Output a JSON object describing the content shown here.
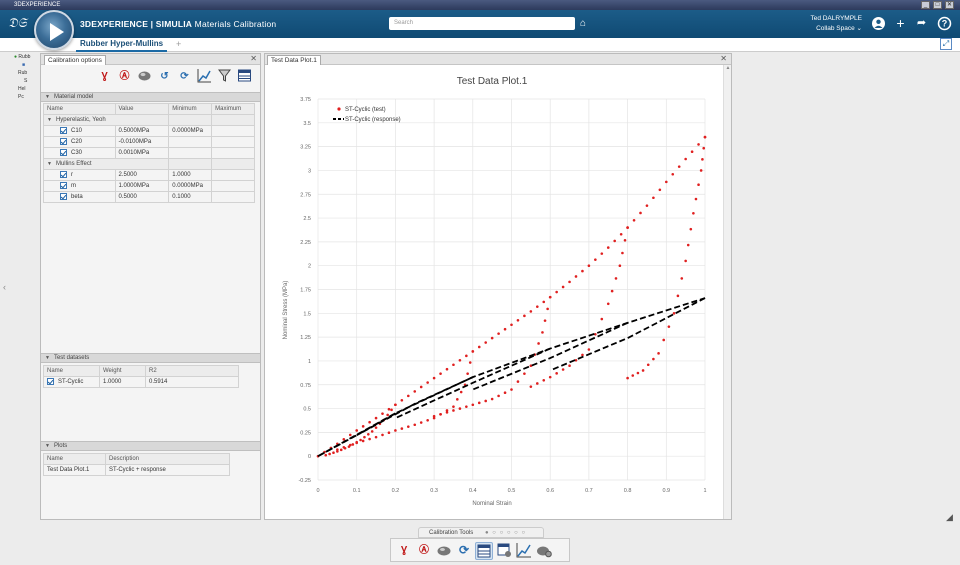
{
  "window": {
    "title": "3DEXPERIENCE",
    "controls": [
      "_",
      "□",
      "✕"
    ]
  },
  "appbar": {
    "brand_prefix": "3D",
    "brand_main": "EXPERIENCE | SIMULIA",
    "brand_app": " Materials Calibration",
    "search_placeholder": "Search",
    "user_name": "Ted DALRYMPLE",
    "collab_space": "Collab Space ⌄"
  },
  "tabs": {
    "active": "Rubber Hyper-Mullins",
    "add": "+"
  },
  "tree": {
    "items": [
      "Rubb",
      "Rub",
      "S",
      "Hel",
      "Pc"
    ]
  },
  "calibration_panel": {
    "title": "Calibration options",
    "close": "✕",
    "material_model": {
      "header": "Material model",
      "columns": [
        "Name",
        "Value",
        "Minimum",
        "Maximum"
      ],
      "groups": [
        {
          "name": "Hyperelastic, Yeoh",
          "rows": [
            {
              "name": "C10",
              "value": "0.5000MPa",
              "min": "0.0000MPa",
              "max": ""
            },
            {
              "name": "C20",
              "value": "-0.0100MPa",
              "min": "",
              "max": ""
            },
            {
              "name": "C30",
              "value": "0.0010MPa",
              "min": "",
              "max": ""
            }
          ]
        },
        {
          "name": "Mullins Effect",
          "rows": [
            {
              "name": "r",
              "value": "2.5000",
              "min": "1.0000",
              "max": ""
            },
            {
              "name": "m",
              "value": "1.0000MPa",
              "min": "0.0000MPa",
              "max": ""
            },
            {
              "name": "beta",
              "value": "0.5000",
              "min": "0.1000",
              "max": ""
            }
          ]
        }
      ]
    },
    "test_datasets": {
      "header": "Test datasets",
      "columns": [
        "Name",
        "Weight",
        "R2"
      ],
      "rows": [
        {
          "name": "ST-Cyclic",
          "weight": "1.0000",
          "r2": "0.5914"
        }
      ]
    },
    "plots": {
      "header": "Plots",
      "columns": [
        "Name",
        "Description"
      ],
      "rows": [
        {
          "name": "Test Data Plot.1",
          "description": "ST-Cyclic + response"
        }
      ]
    }
  },
  "plot_pane": {
    "tab": "Test Data Plot.1",
    "close": "✕"
  },
  "bottom": {
    "tools_label": "Calibration Tools",
    "dots": "● ○ ○ ○ ○ ○"
  },
  "colors": {
    "appbar": "#1c5c88",
    "test_points": "#e02020",
    "response_line": "#000000"
  },
  "chart_data": {
    "type": "scatter",
    "title": "Test Data Plot.1",
    "xlabel": "Nominal Strain",
    "ylabel": "Nominal Stress (MPa)",
    "xlim": [
      0,
      1
    ],
    "ylim": [
      -0.25,
      3.75
    ],
    "x_ticks": [
      "0",
      "0.1",
      "0.2",
      "0.3",
      "0.4",
      "0.5",
      "0.6",
      "0.7",
      "0.8",
      "0.9",
      "1"
    ],
    "y_ticks": [
      "-0.25",
      "0",
      "0.25",
      "0.5",
      "0.75",
      "1",
      "1.25",
      "1.5",
      "1.75",
      "2",
      "2.25",
      "2.5",
      "2.75",
      "3",
      "3.25",
      "3.5",
      "3.75"
    ],
    "grid": true,
    "legend_position": "top-left",
    "series": [
      {
        "name": "ST-Cyclic (test)",
        "style": "dots",
        "color": "#e02020",
        "loops": [
          {
            "x": [
              0,
              0.05,
              0.1,
              0.15,
              0.2,
              0.25,
              0.3,
              0.35,
              0.4,
              0.45,
              0.5,
              0.55,
              0.6,
              0.65,
              0.7,
              0.75,
              0.8,
              0.85,
              0.9,
              0.95,
              1.0
            ],
            "y": [
              0,
              0.13,
              0.27,
              0.4,
              0.54,
              0.68,
              0.82,
              0.96,
              1.1,
              1.24,
              1.38,
              1.52,
              1.67,
              1.83,
              2.0,
              2.19,
              2.4,
              2.63,
              2.88,
              3.12,
              3.35
            ]
          },
          {
            "x": [
              0.2,
              0.17,
              0.14,
              0.11,
              0.08,
              0.05,
              0.02
            ],
            "y": [
              0.54,
              0.38,
              0.26,
              0.17,
              0.1,
              0.05,
              0.01
            ]
          },
          {
            "x": [
              0.4,
              0.38,
              0.35,
              0.3,
              0.25,
              0.2,
              0.15,
              0.1,
              0.05
            ],
            "y": [
              1.1,
              0.75,
              0.52,
              0.4,
              0.33,
              0.27,
              0.2,
              0.14,
              0.07
            ]
          },
          {
            "x": [
              0.6,
              0.58,
              0.55,
              0.5,
              0.45,
              0.4,
              0.35,
              0.3
            ],
            "y": [
              1.67,
              1.3,
              0.95,
              0.7,
              0.6,
              0.54,
              0.48,
              0.42
            ]
          },
          {
            "x": [
              0.8,
              0.78,
              0.75,
              0.7,
              0.65,
              0.6,
              0.55
            ],
            "y": [
              2.4,
              2.0,
              1.6,
              1.12,
              0.95,
              0.83,
              0.73
            ]
          },
          {
            "x": [
              1.0,
              0.99,
              0.97,
              0.95,
              0.92,
              0.88,
              0.84,
              0.8
            ],
            "y": [
              3.35,
              3.0,
              2.55,
              2.05,
              1.5,
              1.08,
              0.9,
              0.82
            ]
          }
        ]
      },
      {
        "name": "ST-Cyclic (response)",
        "style": "dashed",
        "color": "#000000",
        "loops": [
          {
            "x": [
              0,
              0.2,
              0.4,
              0.6,
              0.8,
              1.0
            ],
            "y": [
              0,
              0.45,
              0.83,
              1.13,
              1.4,
              1.66
            ]
          },
          {
            "x": [
              0.2,
              0.1,
              0
            ],
            "y": [
              0.45,
              0.22,
              0
            ]
          },
          {
            "x": [
              0.4,
              0.25,
              0.1
            ],
            "y": [
              0.83,
              0.55,
              0.22
            ]
          },
          {
            "x": [
              0.6,
              0.4,
              0.2
            ],
            "y": [
              1.13,
              0.77,
              0.4
            ]
          },
          {
            "x": [
              0.8,
              0.6,
              0.4
            ],
            "y": [
              1.4,
              1.03,
              0.7
            ]
          },
          {
            "x": [
              1.0,
              0.8,
              0.6
            ],
            "y": [
              1.66,
              1.24,
              0.9
            ]
          }
        ]
      }
    ]
  }
}
